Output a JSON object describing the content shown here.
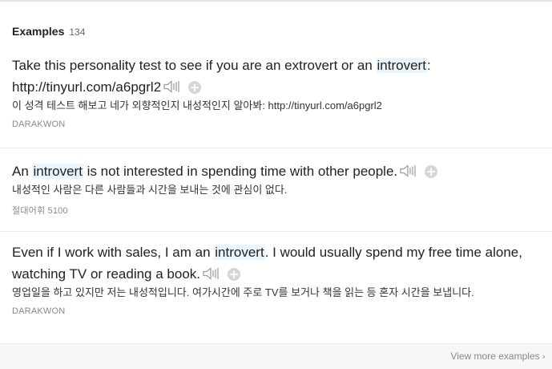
{
  "header": {
    "title": "Examples",
    "count": "134"
  },
  "examples": [
    {
      "before": "Take this personality test to see if you are an extrovert or an ",
      "highlight": "introvert",
      "after": ": http://tinyurl.com/a6pgrl2",
      "translation": "이 성격 테스트 해보고 네가 외향적인지 내성적인지 알아봐: http://tinyurl.com/a6pgrl2",
      "source": "DARAKWON"
    },
    {
      "before": "An ",
      "highlight": "introvert",
      "after": " is not interested in spending time with other people.",
      "translation": "내성적인 사람은 다른 사람들과 시간을 보내는 것에 관심이 없다.",
      "source": "절대어휘 5100"
    },
    {
      "before": "Even if I work with sales, I am an ",
      "highlight": "introvert",
      "after": ". I would usually spend my free time alone, watching TV or reading a book.",
      "translation": "영업일을 하고 있지만 저는 내성적입니다. 여가시간에 주로 TV를 보거나 책을 읽는 등 혼자 시간을 보냅니다.",
      "source": "DARAKWON"
    }
  ],
  "icons": {
    "audio": "speaker-icon",
    "add": "plus-icon",
    "more": "chevron-right-icon"
  },
  "footer": {
    "more_label": "View more examples"
  },
  "colors": {
    "highlight": "#e9f4fc",
    "divider": "#ececec",
    "muted": "#888888"
  }
}
